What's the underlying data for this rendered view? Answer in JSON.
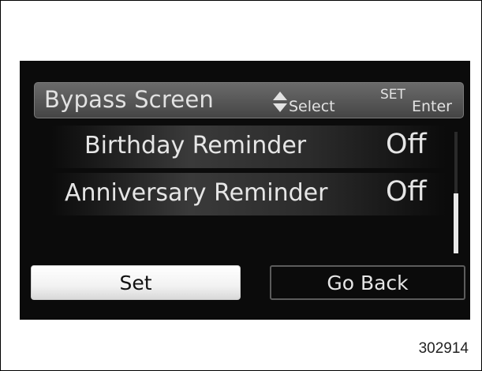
{
  "header": {
    "title": "Bypass Screen",
    "select_hint": "Select",
    "set_key_label": "SET",
    "enter_hint": "Enter"
  },
  "settings": [
    {
      "label": "Birthday Reminder",
      "value": "Off"
    },
    {
      "label": "Anniversary Reminder",
      "value": "Off"
    }
  ],
  "buttons": {
    "set_label": "Set",
    "back_label": "Go Back"
  },
  "figure_number": "302914",
  "colors": {
    "screen_bg": "#0b0b0b",
    "header_bg": "#565656",
    "text": "#e6e6e6",
    "selected_button_bg": "#f2f2f2"
  },
  "icons": {
    "select": "up-down-arrows-icon"
  }
}
